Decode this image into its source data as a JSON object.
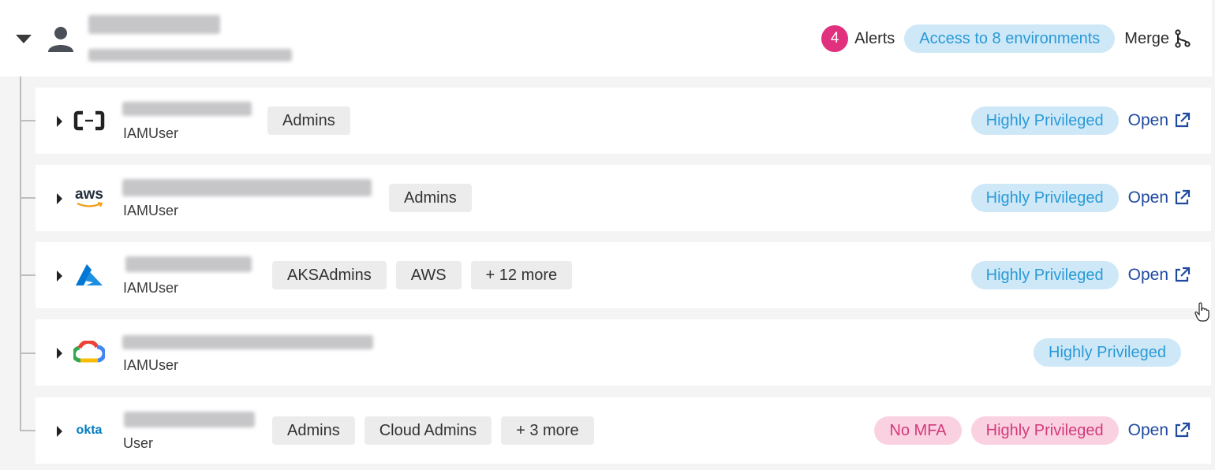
{
  "header": {
    "alerts_count": "4",
    "alerts_label": "Alerts",
    "access_label": "Access to 8 environments",
    "merge_label": "Merge"
  },
  "rows": [
    {
      "provider": "alibaba-cloud",
      "type": "IAMUser",
      "tags": [
        "Admins"
      ],
      "badges": [
        "Highly Privileged"
      ],
      "open_label": "Open"
    },
    {
      "provider": "aws",
      "logo_text": "aws",
      "type": "IAMUser",
      "tags": [
        "Admins"
      ],
      "badges": [
        "Highly Privileged"
      ],
      "open_label": "Open"
    },
    {
      "provider": "azure",
      "type": "IAMUser",
      "tags": [
        "AKSAdmins",
        "AWS",
        "+ 12 more"
      ],
      "badges": [
        "Highly Privileged"
      ],
      "open_label": "Open"
    },
    {
      "provider": "google-cloud",
      "type": "IAMUser",
      "tags": [],
      "badges": [
        "Highly Privileged"
      ]
    },
    {
      "provider": "okta",
      "logo_text": "okta",
      "type": "User",
      "tags": [
        "Admins",
        "Cloud Admins",
        "+ 3 more"
      ],
      "badges": [
        "No MFA",
        "Highly Privileged"
      ],
      "open_label": "Open"
    }
  ],
  "colors": {
    "alert_badge": "#e0307e",
    "privileged_bg": "#cfe8f8",
    "privileged_text": "#2a9ad6",
    "mfa_bg": "#fad1e1",
    "mfa_text": "#d23a7a",
    "link": "#1f4aa0"
  }
}
